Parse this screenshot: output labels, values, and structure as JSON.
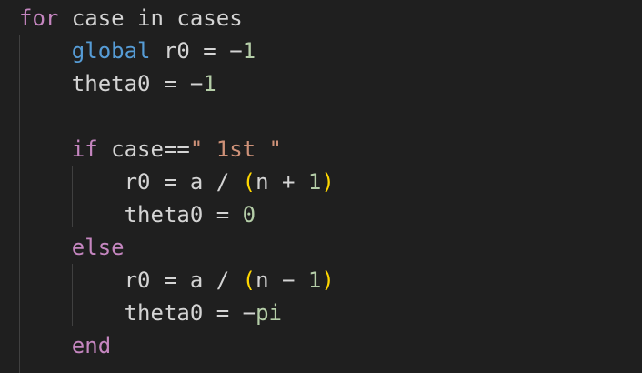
{
  "code": {
    "lines": [
      [
        {
          "t": "for",
          "c": "kw-ctrl"
        },
        {
          "t": " case in cases",
          "c": "plain"
        }
      ],
      [
        {
          "t": "    ",
          "c": "plain"
        },
        {
          "t": "global",
          "c": "kw-decl"
        },
        {
          "t": " r0 = ",
          "c": "plain"
        },
        {
          "t": "−",
          "c": "plain"
        },
        {
          "t": "1",
          "c": "num"
        }
      ],
      [
        {
          "t": "    theta0 = ",
          "c": "plain"
        },
        {
          "t": "−",
          "c": "plain"
        },
        {
          "t": "1",
          "c": "num"
        }
      ],
      [
        {
          "t": "",
          "c": "plain"
        }
      ],
      [
        {
          "t": "    ",
          "c": "plain"
        },
        {
          "t": "if",
          "c": "kw-ctrl"
        },
        {
          "t": " case==",
          "c": "plain"
        },
        {
          "t": "\" 1st \"",
          "c": "str"
        }
      ],
      [
        {
          "t": "        r0 = a / ",
          "c": "plain"
        },
        {
          "t": "(",
          "c": "paren"
        },
        {
          "t": "n + ",
          "c": "plain"
        },
        {
          "t": "1",
          "c": "num"
        },
        {
          "t": ")",
          "c": "paren"
        }
      ],
      [
        {
          "t": "        theta0 = ",
          "c": "plain"
        },
        {
          "t": "0",
          "c": "num"
        }
      ],
      [
        {
          "t": "    ",
          "c": "plain"
        },
        {
          "t": "else",
          "c": "kw-ctrl"
        }
      ],
      [
        {
          "t": "        r0 = a / ",
          "c": "plain"
        },
        {
          "t": "(",
          "c": "paren"
        },
        {
          "t": "n ",
          "c": "plain"
        },
        {
          "t": "−",
          "c": "plain"
        },
        {
          "t": " ",
          "c": "plain"
        },
        {
          "t": "1",
          "c": "num"
        },
        {
          "t": ")",
          "c": "paren"
        }
      ],
      [
        {
          "t": "        theta0 = ",
          "c": "plain"
        },
        {
          "t": "−",
          "c": "plain"
        },
        {
          "t": "pi",
          "c": "num"
        }
      ],
      [
        {
          "t": "    ",
          "c": "plain"
        },
        {
          "t": "end",
          "c": "kw-ctrl"
        }
      ]
    ]
  },
  "colors": {
    "background": "#1f1f1f",
    "control_keyword": "#c586c0",
    "declaration_keyword": "#569cd6",
    "number": "#b5cea8",
    "string": "#ce9178",
    "bracket": "#ffd700",
    "text": "#d4d4d4"
  }
}
